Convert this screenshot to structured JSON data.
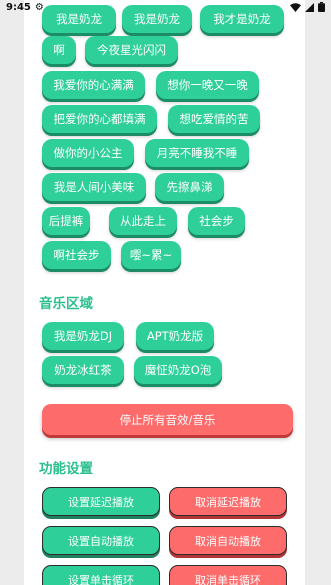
{
  "status_bar": {
    "time": "9:45",
    "gear": "⚙"
  },
  "sound_chips": [
    "我是奶龙",
    "我是奶龙",
    "我才是奶龙",
    "啊",
    "今夜星光闪闪",
    "我爱你的心满满",
    "想你一晚又一晚",
    "把爱你的心都填满",
    "想吃爱情的苦",
    "做你的小公主",
    "月亮不睡我不睡",
    "我是人间小美味",
    "先擦鼻涕",
    "后提裤",
    "从此走上",
    "社会步",
    "啊社会步",
    "嘤~累~"
  ],
  "music_section": {
    "title": "音乐区域",
    "items": [
      "我是奶龙DJ",
      "APT奶龙版",
      "奶龙冰红茶",
      "魔怔奶龙O泡"
    ]
  },
  "stop_button": "停止所有音效/音乐",
  "function_section": {
    "title": "功能设置",
    "set_delay": "设置延迟播放",
    "cancel_delay": "取消延迟播放",
    "set_auto": "设置自动播放",
    "cancel_auto": "取消自动播放",
    "set_loop": "设置单击循环",
    "cancel_loop": "取消单击循环"
  },
  "colors": {
    "chip_green": "#2fcf9a",
    "section_title": "#2bbf8e",
    "stop_red": "#fd6b6b",
    "background": "#ececec"
  }
}
